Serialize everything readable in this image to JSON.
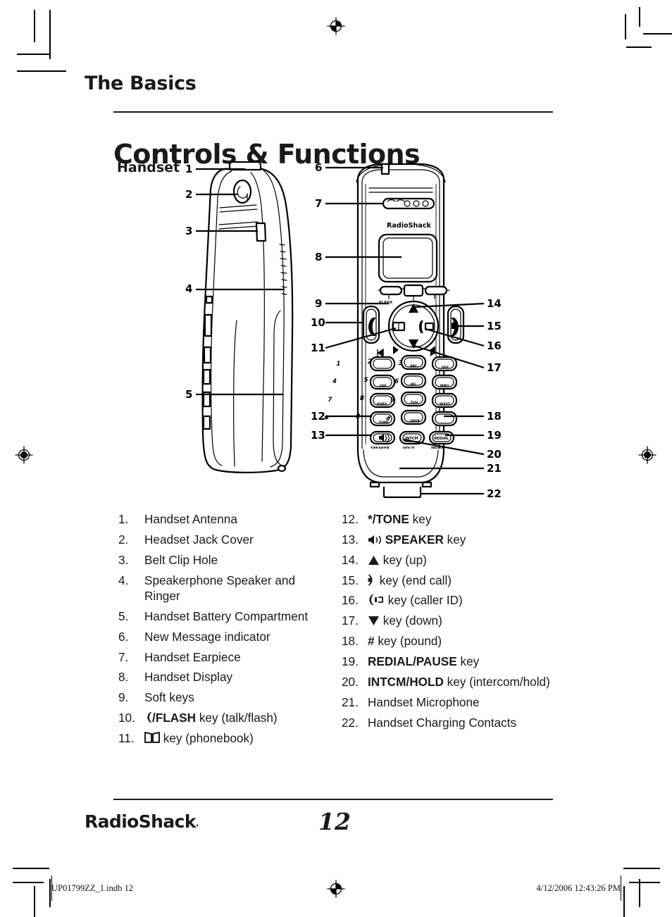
{
  "header": {
    "running_head": "The Basics",
    "title": "Controls & Functions",
    "subtitle": "Handset"
  },
  "figure": {
    "brand_on_handset": "RadioShack",
    "key_labels": {
      "flash": "FLASH",
      "speaker": "SPEAKER",
      "hold": "HOLD",
      "pause": "PAUSE",
      "intcm": "INTCM",
      "redial": "REDIAL",
      "tone": "TONE",
      "oper": "OPER"
    },
    "keypad": [
      {
        "digit": "1",
        "letters": ""
      },
      {
        "digit": "2",
        "letters": "ABC"
      },
      {
        "digit": "3",
        "letters": "DEF"
      },
      {
        "digit": "4",
        "letters": "GHI"
      },
      {
        "digit": "5",
        "letters": "JKL"
      },
      {
        "digit": "6",
        "letters": "MNO"
      },
      {
        "digit": "7",
        "letters": "PQRS"
      },
      {
        "digit": "8",
        "letters": "TUV"
      },
      {
        "digit": "9",
        "letters": "WXYZ"
      }
    ],
    "callout_numbers_left_view": [
      "1",
      "2",
      "3",
      "4",
      "5"
    ],
    "callout_numbers_front_view_left": [
      "6",
      "7",
      "8",
      "9",
      "10",
      "11",
      "12",
      "13"
    ],
    "callout_numbers_front_view_right": [
      "14",
      "15",
      "16",
      "17",
      "18",
      "19",
      "20",
      "21",
      "22"
    ]
  },
  "legend": {
    "left_column": [
      {
        "num": "1.",
        "text": "Handset Antenna"
      },
      {
        "num": "2.",
        "text": "Headset Jack Cover"
      },
      {
        "num": "3.",
        "text": "Belt Clip Hole"
      },
      {
        "num": "4.",
        "text": "Speakerphone Speaker and Ringer"
      },
      {
        "num": "5.",
        "text": "Handset Battery Compartment"
      },
      {
        "num": "6.",
        "text": "New Message indicator"
      },
      {
        "num": "7.",
        "text": "Handset Earpiece"
      },
      {
        "num": "8.",
        "text": "Handset Display"
      },
      {
        "num": "9.",
        "text": "Soft keys"
      },
      {
        "num": "10.",
        "icon": "talk-handset-icon",
        "bold": "/FLASH",
        "text": " key (talk/flash)"
      },
      {
        "num": "11.",
        "icon": "phonebook-icon",
        "text": " key (phonebook)"
      }
    ],
    "right_column": [
      {
        "num": "12.",
        "bold": "*/TONE",
        "text": " key"
      },
      {
        "num": "13.",
        "icon": "speaker-icon",
        "bold": " SPEAKER",
        "text": " key"
      },
      {
        "num": "14.",
        "icon": "triangle-up-icon",
        "text": " key (up)"
      },
      {
        "num": "15.",
        "icon": "end-call-icon",
        "text": " key (end call)"
      },
      {
        "num": "16.",
        "icon": "caller-id-icon",
        "text": " key (caller ID)"
      },
      {
        "num": "17.",
        "icon": "triangle-down-icon",
        "text": " key (down)"
      },
      {
        "num": "18.",
        "bold": "#",
        "text": " key (pound)"
      },
      {
        "num": "19.",
        "bold": "REDIAL/PAUSE",
        "text": " key"
      },
      {
        "num": "20.",
        "bold": "INTCM/HOLD",
        "text": " key (intercom/hold)"
      },
      {
        "num": "21.",
        "text": "Handset Microphone"
      },
      {
        "num": "22.",
        "text": "Handset Charging Contacts"
      }
    ]
  },
  "footer": {
    "brand": "RadioShack",
    "brand_tm": ".",
    "page_number": "12"
  },
  "slug": {
    "left": "UP01799ZZ_1.indb   12",
    "right": "4/12/2006   12:43:26 PM"
  },
  "colors": {
    "ink": "#1a1a1a",
    "paper": "#ffffff",
    "line": "#000000"
  }
}
